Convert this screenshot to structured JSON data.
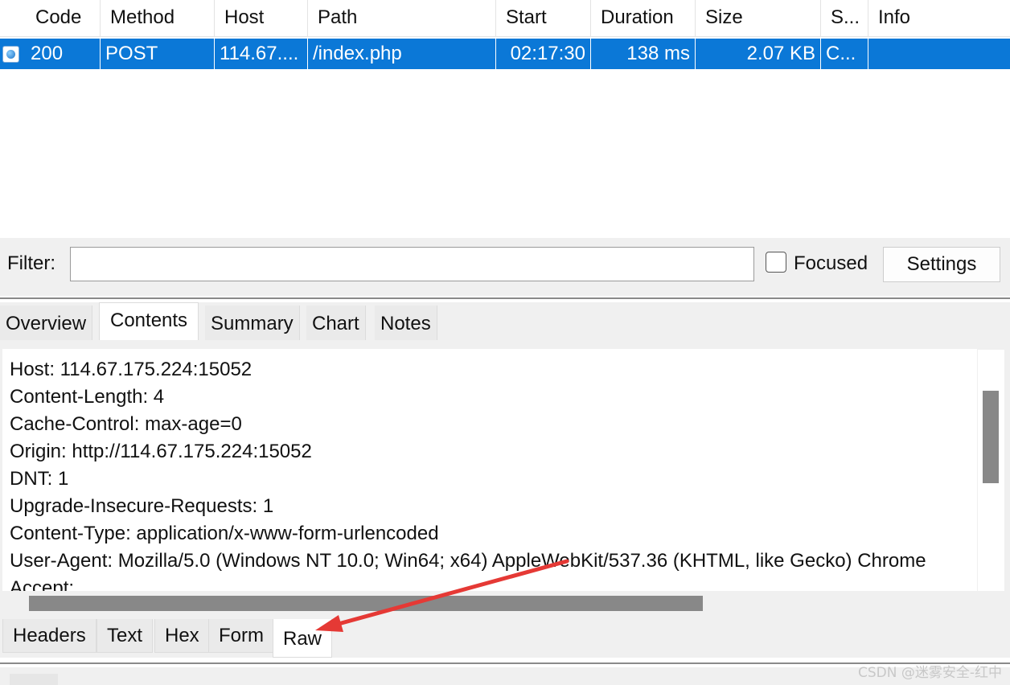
{
  "table": {
    "columns": [
      {
        "label": "Code"
      },
      {
        "label": "Method"
      },
      {
        "label": "Host"
      },
      {
        "label": "Path"
      },
      {
        "label": "Start"
      },
      {
        "label": "Duration"
      },
      {
        "label": "Size"
      },
      {
        "label": "S..."
      },
      {
        "label": "Info"
      }
    ],
    "rows": [
      {
        "icon": "web-request-icon",
        "code": "200",
        "method": "POST",
        "host": "114.67....",
        "path": "/index.php",
        "start": "02:17:30",
        "duration": "138 ms",
        "size": "2.07 KB",
        "status": "C...",
        "info": ""
      }
    ]
  },
  "filter": {
    "label": "Filter:",
    "value": "",
    "focused_label": "Focused",
    "focused_checked": false,
    "settings_label": "Settings"
  },
  "tabs_top": [
    {
      "label": "Overview",
      "active": false
    },
    {
      "label": "Contents",
      "active": true
    },
    {
      "label": "Summary",
      "active": false
    },
    {
      "label": "Chart",
      "active": false
    },
    {
      "label": "Notes",
      "active": false
    }
  ],
  "content_lines": [
    "Host: 114.67.175.224:15052",
    "Content-Length: 4",
    "Cache-Control: max-age=0",
    "Origin: http://114.67.175.224:15052",
    "DNT: 1",
    "Upgrade-Insecure-Requests: 1",
    "Content-Type: application/x-www-form-urlencoded",
    "User-Agent: Mozilla/5.0 (Windows NT 10.0; Win64; x64) AppleWebKit/537.36 (KHTML, like Gecko) Chrome",
    "Accept:"
  ],
  "tabs_bottom": [
    {
      "label": "Headers",
      "active": false
    },
    {
      "label": "Text",
      "active": false
    },
    {
      "label": "Hex",
      "active": false
    },
    {
      "label": "Form",
      "active": false
    },
    {
      "label": "Raw",
      "active": true
    }
  ],
  "watermark": "CSDN @迷雾安全-红中",
  "colors": {
    "selection": "#0b78d7",
    "annotation_arrow": "#e53935"
  }
}
